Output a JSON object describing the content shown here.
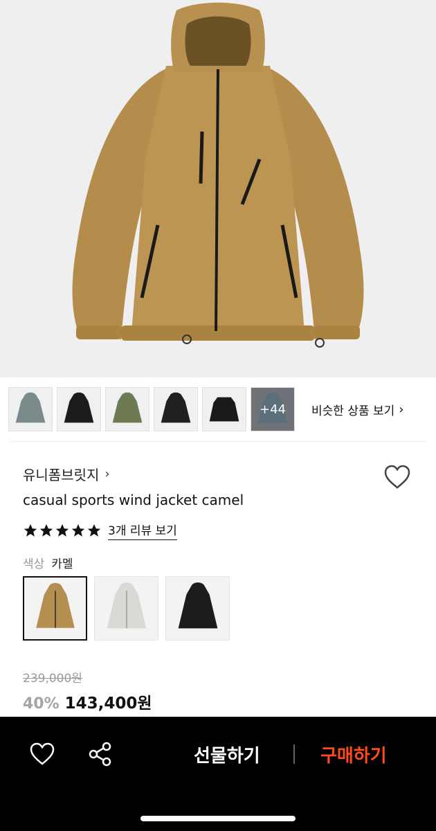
{
  "hero": {
    "image": "camel-hooded-wind-jacket"
  },
  "thumbnails": [
    {
      "color": "#7b8a8a",
      "name": "gray-green-jacket"
    },
    {
      "color": "#1c1c1c",
      "name": "black-jacket"
    },
    {
      "color": "#6d7a52",
      "name": "olive-jacket"
    },
    {
      "color": "#202020",
      "name": "black-jacket-2"
    },
    {
      "color": "#1a1a1a",
      "name": "black-zip-jacket"
    },
    {
      "color": "#5a6f7a",
      "name": "blue-gray-jacket",
      "more": "+44"
    }
  ],
  "similar": {
    "label": "비슷한 상품 보기",
    "chevron": "›"
  },
  "product": {
    "brand": "유니폼브릿지",
    "brand_chevron": "›",
    "name": "casual sports wind jacket camel",
    "rating_stars": 5,
    "review_link": "3개 리뷰 보기",
    "color_label": "색상",
    "color_value": "카멜"
  },
  "swatches": [
    {
      "name": "camel",
      "color": "#b58f4f",
      "selected": true
    },
    {
      "name": "light-gray",
      "color": "#d9d9d6",
      "selected": false
    },
    {
      "name": "black",
      "color": "#1c1c1c",
      "selected": false
    }
  ],
  "price": {
    "original": "239,000원",
    "discount": "40%",
    "current": "143,400원"
  },
  "bottom_bar": {
    "gift": "선물하기",
    "buy": "구매하기",
    "buy_color": "#ff4a1a"
  }
}
